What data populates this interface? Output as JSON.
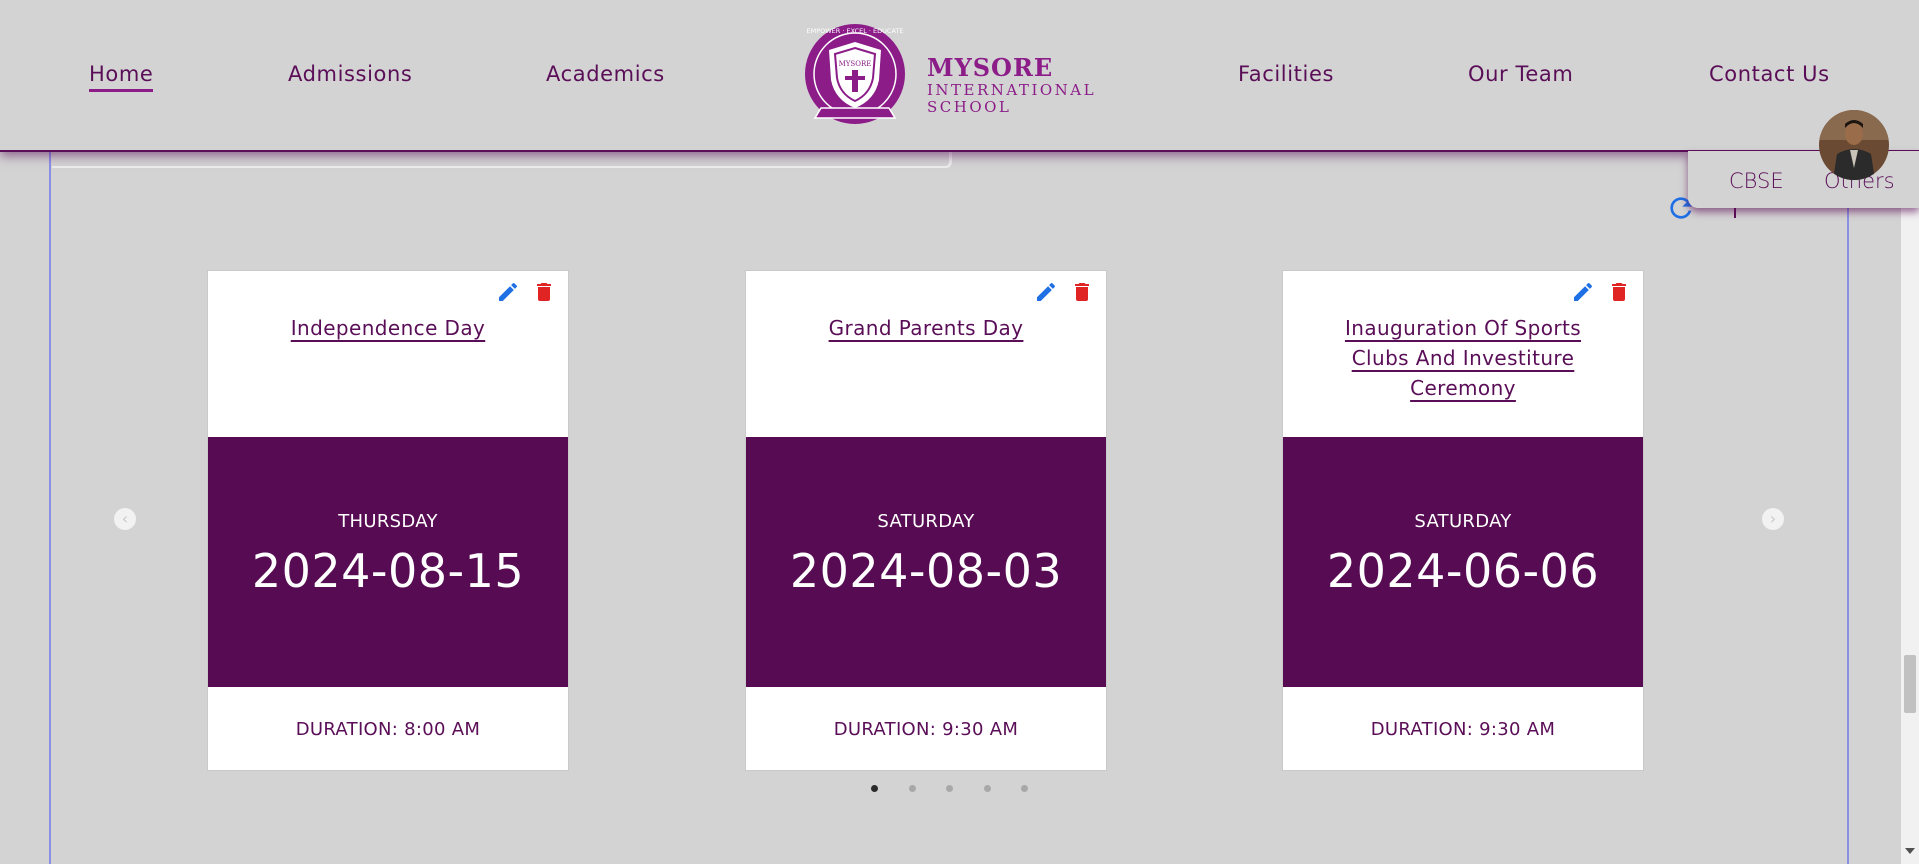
{
  "nav": {
    "links": [
      {
        "label": "Home",
        "active": true
      },
      {
        "label": "Admissions",
        "active": false
      },
      {
        "label": "Academics",
        "active": false
      },
      {
        "label": "Facilities",
        "active": false
      },
      {
        "label": "Our Team",
        "active": false
      },
      {
        "label": "Contact Us",
        "active": false
      }
    ]
  },
  "logo": {
    "emblem_name": "MYSORE",
    "emblem_motto": "EMPOWER · EXCEL · EDUCATE",
    "line1": "MYSORE",
    "line2": "INTERNATIONAL",
    "line3": "SCHOOL"
  },
  "dropdown": {
    "items": [
      "CBSE",
      "Others"
    ]
  },
  "colors": {
    "brand": "#5a0e57",
    "band": "#560b52",
    "edit": "#1f6fe5",
    "delete": "#e02424",
    "background": "#d3d3d3"
  },
  "events": [
    {
      "title": "Independence Day",
      "day": "THURSDAY",
      "date": "2024-08-15",
      "duration": "DURATION: 8:00 AM"
    },
    {
      "title": "Grand Parents Day",
      "day": "SATURDAY",
      "date": "2024-08-03",
      "duration": "DURATION: 9:30 AM"
    },
    {
      "title": "Inauguration Of Sports Clubs And Investiture Ceremony",
      "day": "SATURDAY",
      "date": "2024-06-06",
      "duration": "DURATION: 9:30 AM"
    }
  ],
  "carousel": {
    "prev_icon": "chevron-left-icon",
    "next_icon": "chevron-right-icon",
    "pages": 5,
    "active_page": 1
  }
}
